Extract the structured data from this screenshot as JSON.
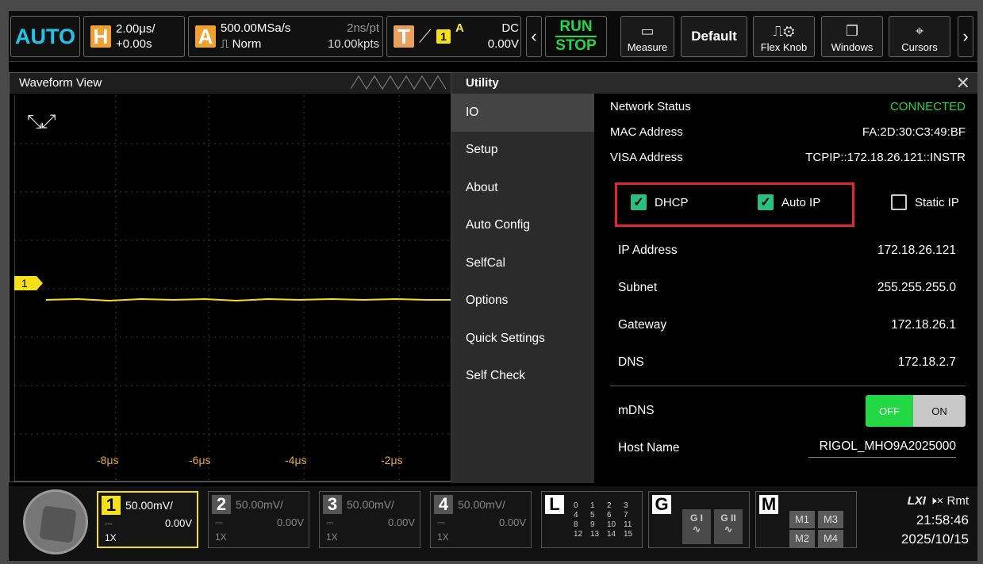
{
  "topbar": {
    "auto": "AUTO",
    "horizontal": {
      "letter": "H",
      "timebase": "2.00μs/",
      "offset": "+0.00s"
    },
    "acquire": {
      "letter": "A",
      "rate": "500.00MSa/s",
      "mode": "Norm",
      "pt": "2ns/pt",
      "depth": "10.00kpts"
    },
    "trigger": {
      "letter": "T",
      "channel": "1",
      "source": "A",
      "coupling": "DC",
      "level": "0.00V"
    },
    "run": "RUN",
    "stop": "STOP",
    "buttons": {
      "measure": "Measure",
      "default": "Default",
      "flex_knob": "Flex Knob",
      "windows": "Windows",
      "cursors": "Cursors"
    }
  },
  "waveform": {
    "title": "Waveform View",
    "channel_marker": "1",
    "x_labels": [
      "-8μs",
      "-6μs",
      "-4μs",
      "-2μs"
    ]
  },
  "utility": {
    "title": "Utility",
    "menu": [
      "IO",
      "Setup",
      "About",
      "Auto Config",
      "SelfCal",
      "Options",
      "Quick Settings",
      "Self Check"
    ],
    "active_menu": "IO",
    "info": [
      {
        "label": "Network Status",
        "value": "CONNECTED"
      },
      {
        "label": "MAC Address",
        "value": "FA:2D:30:C3:49:BF"
      },
      {
        "label": "VISA Address",
        "value": "TCPIP::172.18.26.121::INSTR"
      }
    ],
    "checkboxes": [
      {
        "label": "DHCP",
        "checked": true
      },
      {
        "label": "Auto IP",
        "checked": true
      },
      {
        "label": "Static IP",
        "checked": false
      }
    ],
    "fields": [
      {
        "label": "IP Address",
        "value": "172.18.26.121"
      },
      {
        "label": "Subnet",
        "value": "255.255.255.0"
      },
      {
        "label": "Gateway",
        "value": "172.18.26.1"
      },
      {
        "label": "DNS",
        "value": "172.18.2.7"
      }
    ],
    "mdns": {
      "label": "mDNS",
      "off": "OFF",
      "on": "ON",
      "state": "OFF"
    },
    "host": {
      "label": "Host Name",
      "value": "RIGOL_MHO9A2025000"
    }
  },
  "channels": [
    {
      "num": "1",
      "scale": "50.00mV/",
      "offset": "0.00V",
      "probe": "1X",
      "active": true
    },
    {
      "num": "2",
      "scale": "50.00mV/",
      "offset": "0.00V",
      "probe": "1X",
      "active": false
    },
    {
      "num": "3",
      "scale": "50.00mV/",
      "offset": "0.00V",
      "probe": "1X",
      "active": false
    },
    {
      "num": "4",
      "scale": "50.00mV/",
      "offset": "0.00V",
      "probe": "1X",
      "active": false
    }
  ],
  "logic": {
    "label": "L",
    "digits": [
      "0",
      "1",
      "2",
      "3",
      "4",
      "5",
      "6",
      "7",
      "8",
      "9",
      "10",
      "11",
      "12",
      "13",
      "14",
      "15"
    ]
  },
  "generator": {
    "label": "G",
    "g1": "G I",
    "g2": "G II"
  },
  "math": {
    "label": "M",
    "items": [
      "M1",
      "M3",
      "M2",
      "M4"
    ]
  },
  "status": {
    "lxi": "LXI",
    "rmt": "Rmt",
    "time": "21:58:46",
    "date": "2025/10/15"
  },
  "colors": {
    "accent_cyan": "#22c5e8",
    "run_green": "#22d845",
    "ch1_yellow": "#f5e01a",
    "highlight_red": "#e0282a"
  }
}
